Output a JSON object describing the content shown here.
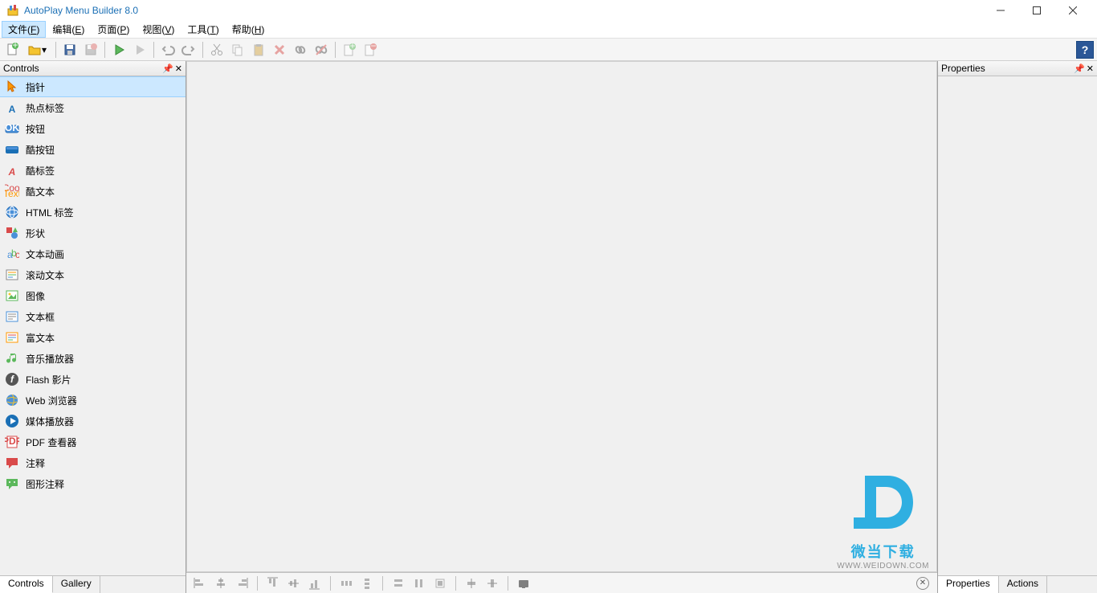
{
  "title": "AutoPlay Menu Builder 8.0",
  "menubar": [
    {
      "label": "文件",
      "key": "F",
      "highlighted": true
    },
    {
      "label": "编辑",
      "key": "E"
    },
    {
      "label": "页面",
      "key": "P"
    },
    {
      "label": "视图",
      "key": "V"
    },
    {
      "label": "工具",
      "key": "T"
    },
    {
      "label": "帮助",
      "key": "H"
    }
  ],
  "toolbar_icons": [
    {
      "name": "new-file",
      "type": "new"
    },
    {
      "name": "open-file",
      "type": "open",
      "arrow": true
    },
    {
      "name": "sep"
    },
    {
      "name": "save",
      "type": "save"
    },
    {
      "name": "save-disabled",
      "type": "save-x"
    },
    {
      "name": "sep"
    },
    {
      "name": "play",
      "type": "play"
    },
    {
      "name": "play-disabled",
      "type": "play-x"
    },
    {
      "name": "sep"
    },
    {
      "name": "undo",
      "type": "undo"
    },
    {
      "name": "redo",
      "type": "redo"
    },
    {
      "name": "sep"
    },
    {
      "name": "cut",
      "type": "cut"
    },
    {
      "name": "copy",
      "type": "copy"
    },
    {
      "name": "paste",
      "type": "paste"
    },
    {
      "name": "delete",
      "type": "delete"
    },
    {
      "name": "link",
      "type": "link"
    },
    {
      "name": "link-break",
      "type": "linkx"
    },
    {
      "name": "sep"
    },
    {
      "name": "add-page",
      "type": "addpage"
    },
    {
      "name": "remove-page",
      "type": "rmpage"
    }
  ],
  "left_panel": {
    "title": "Controls",
    "tabs": [
      "Controls",
      "Gallery"
    ],
    "active_tab": 0,
    "items": [
      {
        "label": "指针",
        "icon": "pointer",
        "selected": true
      },
      {
        "label": "热点标签",
        "icon": "letter-a-blue"
      },
      {
        "label": "按钮",
        "icon": "ok-button"
      },
      {
        "label": "酷按钮",
        "icon": "cool-button"
      },
      {
        "label": "酷标签",
        "icon": "letter-a-red"
      },
      {
        "label": "酷文本",
        "icon": "cool-text"
      },
      {
        "label": "HTML 标签",
        "icon": "globe"
      },
      {
        "label": "形状",
        "icon": "shapes"
      },
      {
        "label": "文本动画",
        "icon": "text-anim"
      },
      {
        "label": "滚动文本",
        "icon": "scroll-text"
      },
      {
        "label": "图像",
        "icon": "image"
      },
      {
        "label": "文本框",
        "icon": "textbox"
      },
      {
        "label": "富文本",
        "icon": "richtext"
      },
      {
        "label": "音乐播放器",
        "icon": "music"
      },
      {
        "label": "Flash 影片",
        "icon": "flash"
      },
      {
        "label": "Web 浏览器",
        "icon": "browser"
      },
      {
        "label": "媒体播放器",
        "icon": "media"
      },
      {
        "label": "PDF 查看器",
        "icon": "pdf"
      },
      {
        "label": "注释",
        "icon": "comment"
      },
      {
        "label": "图形注释",
        "icon": "graphic-comment"
      }
    ]
  },
  "right_panel": {
    "title": "Properties",
    "tabs": [
      "Properties",
      "Actions"
    ],
    "active_tab": 0
  },
  "watermark": {
    "text": "微当下载",
    "url": "WWW.WEIDOWN.COM"
  }
}
